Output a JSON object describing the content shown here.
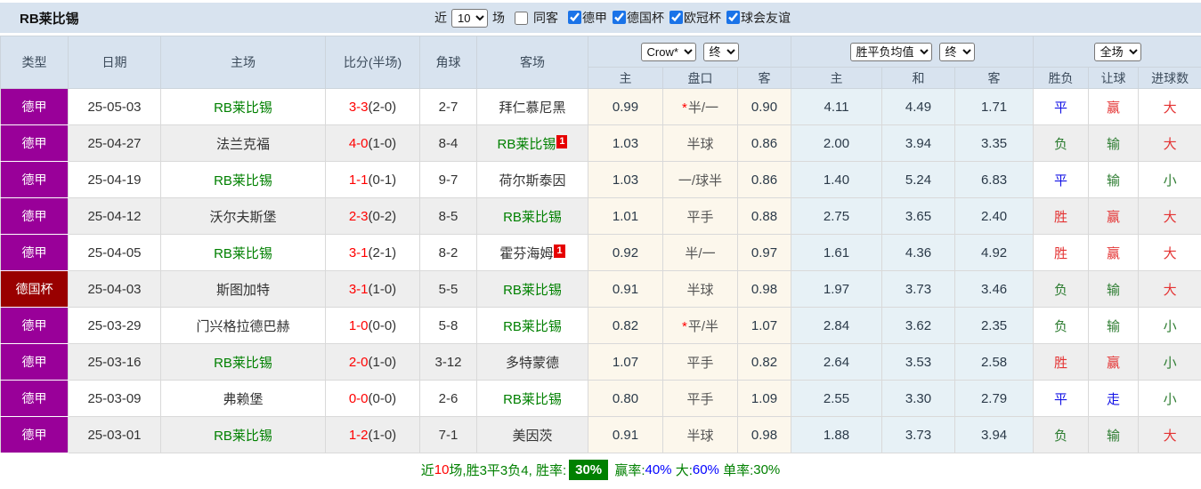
{
  "title": "RB莱比锡",
  "topbar": {
    "near_label": "近",
    "near_value": "10",
    "games_label": "场",
    "same_opponent_label": "同客",
    "same_opponent_checked": false,
    "filters": [
      {
        "label": "德甲",
        "checked": true
      },
      {
        "label": "德国杯",
        "checked": true
      },
      {
        "label": "欧冠杯",
        "checked": true
      },
      {
        "label": "球会友谊",
        "checked": true
      }
    ],
    "checkbox_accent": "#1a73e8"
  },
  "table": {
    "static_headers": [
      "类型",
      "日期",
      "主场",
      "比分(半场)",
      "角球",
      "客场"
    ],
    "odds_group": {
      "bookmaker_select": "Crow*",
      "period_select": "终",
      "sub_headers": [
        "主",
        "盘口",
        "客"
      ]
    },
    "avg_group": {
      "name_select": "胜平负均值",
      "period_select": "终",
      "sub_headers": [
        "主",
        "和",
        "客"
      ]
    },
    "result_group": {
      "scope_select": "全场",
      "sub_headers": [
        "胜负",
        "让球",
        "进球数"
      ]
    },
    "type_colors": {
      "德甲": "#990099",
      "德国杯": "#990000"
    },
    "rows": [
      {
        "type": "德甲",
        "type_bg": "#990099",
        "date": "25-05-03",
        "home": {
          "name": "RB莱比锡",
          "highlight": true,
          "badge": ""
        },
        "score_ft": "3-3",
        "score_ht": "(2-0)",
        "corners": "2-7",
        "away": {
          "name": "拜仁慕尼黑",
          "highlight": false,
          "badge": ""
        },
        "odds": {
          "home": "0.99",
          "star": true,
          "handicap": "半/一",
          "away": "0.90"
        },
        "avg": {
          "home": "4.11",
          "draw": "4.49",
          "away": "1.71"
        },
        "result": {
          "wdl": "平",
          "wdl_c": "blue",
          "let": "赢",
          "let_c": "red",
          "goals": "大",
          "goals_c": "red"
        }
      },
      {
        "type": "德甲",
        "type_bg": "#990099",
        "date": "25-04-27",
        "home": {
          "name": "法兰克福",
          "highlight": false,
          "badge": ""
        },
        "score_ft": "4-0",
        "score_ht": "(1-0)",
        "corners": "8-4",
        "away": {
          "name": "RB莱比锡",
          "highlight": true,
          "badge": "1"
        },
        "odds": {
          "home": "1.03",
          "star": false,
          "handicap": "半球",
          "away": "0.86"
        },
        "avg": {
          "home": "2.00",
          "draw": "3.94",
          "away": "3.35"
        },
        "result": {
          "wdl": "负",
          "wdl_c": "green",
          "let": "输",
          "let_c": "green",
          "goals": "大",
          "goals_c": "red"
        }
      },
      {
        "type": "德甲",
        "type_bg": "#990099",
        "date": "25-04-19",
        "home": {
          "name": "RB莱比锡",
          "highlight": true,
          "badge": ""
        },
        "score_ft": "1-1",
        "score_ht": "(0-1)",
        "corners": "9-7",
        "away": {
          "name": "荷尔斯泰因",
          "highlight": false,
          "badge": ""
        },
        "odds": {
          "home": "1.03",
          "star": false,
          "handicap": "一/球半",
          "away": "0.86"
        },
        "avg": {
          "home": "1.40",
          "draw": "5.24",
          "away": "6.83"
        },
        "result": {
          "wdl": "平",
          "wdl_c": "blue",
          "let": "输",
          "let_c": "green",
          "goals": "小",
          "goals_c": "green"
        }
      },
      {
        "type": "德甲",
        "type_bg": "#990099",
        "date": "25-04-12",
        "home": {
          "name": "沃尔夫斯堡",
          "highlight": false,
          "badge": ""
        },
        "score_ft": "2-3",
        "score_ht": "(0-2)",
        "corners": "8-5",
        "away": {
          "name": "RB莱比锡",
          "highlight": true,
          "badge": ""
        },
        "odds": {
          "home": "1.01",
          "star": false,
          "handicap": "平手",
          "away": "0.88"
        },
        "avg": {
          "home": "2.75",
          "draw": "3.65",
          "away": "2.40"
        },
        "result": {
          "wdl": "胜",
          "wdl_c": "red",
          "let": "赢",
          "let_c": "red",
          "goals": "大",
          "goals_c": "red"
        }
      },
      {
        "type": "德甲",
        "type_bg": "#990099",
        "date": "25-04-05",
        "home": {
          "name": "RB莱比锡",
          "highlight": true,
          "badge": ""
        },
        "score_ft": "3-1",
        "score_ht": "(2-1)",
        "corners": "8-2",
        "away": {
          "name": "霍芬海姆",
          "highlight": false,
          "badge": "1"
        },
        "odds": {
          "home": "0.92",
          "star": false,
          "handicap": "半/一",
          "away": "0.97"
        },
        "avg": {
          "home": "1.61",
          "draw": "4.36",
          "away": "4.92"
        },
        "result": {
          "wdl": "胜",
          "wdl_c": "red",
          "let": "赢",
          "let_c": "red",
          "goals": "大",
          "goals_c": "red"
        }
      },
      {
        "type": "德国杯",
        "type_bg": "#990000",
        "date": "25-04-03",
        "home": {
          "name": "斯图加特",
          "highlight": false,
          "badge": ""
        },
        "score_ft": "3-1",
        "score_ht": "(1-0)",
        "corners": "5-5",
        "away": {
          "name": "RB莱比锡",
          "highlight": true,
          "badge": ""
        },
        "odds": {
          "home": "0.91",
          "star": false,
          "handicap": "半球",
          "away": "0.98"
        },
        "avg": {
          "home": "1.97",
          "draw": "3.73",
          "away": "3.46"
        },
        "result": {
          "wdl": "负",
          "wdl_c": "green",
          "let": "输",
          "let_c": "green",
          "goals": "大",
          "goals_c": "red"
        }
      },
      {
        "type": "德甲",
        "type_bg": "#990099",
        "date": "25-03-29",
        "home": {
          "name": "门兴格拉德巴赫",
          "highlight": false,
          "badge": ""
        },
        "score_ft": "1-0",
        "score_ht": "(0-0)",
        "corners": "5-8",
        "away": {
          "name": "RB莱比锡",
          "highlight": true,
          "badge": ""
        },
        "odds": {
          "home": "0.82",
          "star": true,
          "handicap": "平/半",
          "away": "1.07"
        },
        "avg": {
          "home": "2.84",
          "draw": "3.62",
          "away": "2.35"
        },
        "result": {
          "wdl": "负",
          "wdl_c": "green",
          "let": "输",
          "let_c": "green",
          "goals": "小",
          "goals_c": "green"
        }
      },
      {
        "type": "德甲",
        "type_bg": "#990099",
        "date": "25-03-16",
        "home": {
          "name": "RB莱比锡",
          "highlight": true,
          "badge": ""
        },
        "score_ft": "2-0",
        "score_ht": "(1-0)",
        "corners": "3-12",
        "away": {
          "name": "多特蒙德",
          "highlight": false,
          "badge": ""
        },
        "odds": {
          "home": "1.07",
          "star": false,
          "handicap": "平手",
          "away": "0.82"
        },
        "avg": {
          "home": "2.64",
          "draw": "3.53",
          "away": "2.58"
        },
        "result": {
          "wdl": "胜",
          "wdl_c": "red",
          "let": "赢",
          "let_c": "red",
          "goals": "小",
          "goals_c": "green"
        }
      },
      {
        "type": "德甲",
        "type_bg": "#990099",
        "date": "25-03-09",
        "home": {
          "name": "弗赖堡",
          "highlight": false,
          "badge": ""
        },
        "score_ft": "0-0",
        "score_ht": "(0-0)",
        "corners": "2-6",
        "away": {
          "name": "RB莱比锡",
          "highlight": true,
          "badge": ""
        },
        "odds": {
          "home": "0.80",
          "star": false,
          "handicap": "平手",
          "away": "1.09"
        },
        "avg": {
          "home": "2.55",
          "draw": "3.30",
          "away": "2.79"
        },
        "result": {
          "wdl": "平",
          "wdl_c": "blue",
          "let": "走",
          "let_c": "blue",
          "goals": "小",
          "goals_c": "green"
        }
      },
      {
        "type": "德甲",
        "type_bg": "#990099",
        "date": "25-03-01",
        "home": {
          "name": "RB莱比锡",
          "highlight": true,
          "badge": ""
        },
        "score_ft": "1-2",
        "score_ht": "(1-0)",
        "corners": "7-1",
        "away": {
          "name": "美因茨",
          "highlight": false,
          "badge": ""
        },
        "odds": {
          "home": "0.91",
          "star": false,
          "handicap": "半球",
          "away": "0.98"
        },
        "avg": {
          "home": "1.88",
          "draw": "3.73",
          "away": "3.94"
        },
        "result": {
          "wdl": "负",
          "wdl_c": "green",
          "let": "输",
          "let_c": "green",
          "goals": "大",
          "goals_c": "red"
        }
      }
    ]
  },
  "summary": {
    "segments": [
      {
        "text": "近",
        "c": "green"
      },
      {
        "text": "10",
        "c": "red"
      },
      {
        "text": "场,胜3平3负4, 胜率:",
        "c": "green"
      },
      {
        "text": "30%",
        "c": "badge"
      },
      {
        "text": " 赢率:",
        "c": "green"
      },
      {
        "text": "40%",
        "c": "blue"
      },
      {
        "text": " 大:",
        "c": "green"
      },
      {
        "text": "60%",
        "c": "blue"
      },
      {
        "text": " 单率:",
        "c": "green"
      },
      {
        "text": "30%",
        "c": "green"
      }
    ]
  },
  "colors": {
    "header_bg": "#d8e3ef",
    "league_badge": "#990099",
    "cup_badge": "#990000",
    "team_highlight": "#008000",
    "score_red": "#ff0000",
    "win_red": "#e43333",
    "draw_blue": "#1414e6",
    "loss_green": "#2e7d32",
    "summary_badge_bg": "#008000"
  }
}
